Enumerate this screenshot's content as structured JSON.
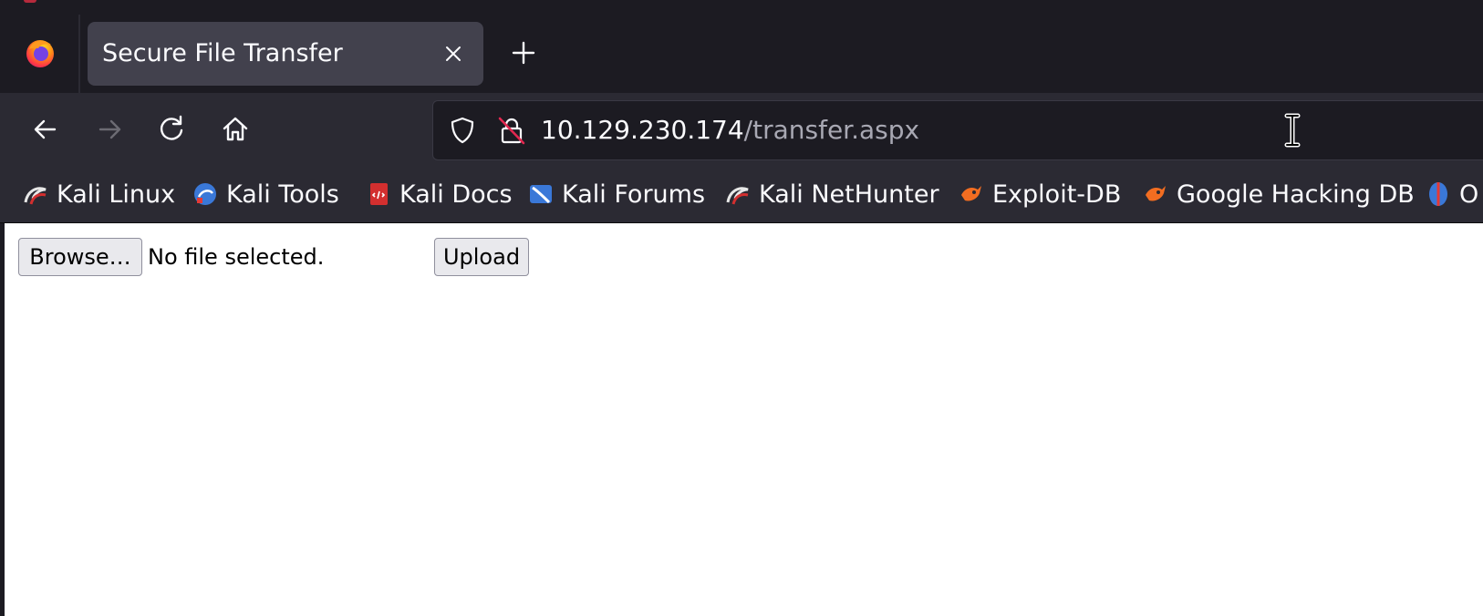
{
  "browser": {
    "logo_icon": "firefox-icon",
    "colors": {
      "chrome_dark": "#1c1b22",
      "toolbar": "#2b2a33",
      "tab_active": "#42414d",
      "text": "#fbfbfe",
      "url_path": "#a8a8b3"
    }
  },
  "tabs": [
    {
      "title": "Secure File Transfer",
      "close_icon": "close-icon",
      "active": true
    }
  ],
  "new_tab_icon": "plus-icon",
  "nav": {
    "back_icon": "arrow-left-icon",
    "forward_icon": "arrow-right-icon",
    "reload_icon": "reload-icon",
    "home_icon": "home-icon"
  },
  "urlbar": {
    "shield_icon": "shield-icon",
    "lock_icon": "insecure-lock-icon",
    "host": "10.129.230.174",
    "path": "/transfer.aspx"
  },
  "bookmarks": [
    {
      "label": "Kali Linux",
      "icon": "kali-dragon-icon"
    },
    {
      "label": "Kali Tools",
      "icon": "kali-tools-icon"
    },
    {
      "label": "Kali Docs",
      "icon": "kali-docs-icon"
    },
    {
      "label": "Kali Forums",
      "icon": "kali-forums-icon"
    },
    {
      "label": "Kali NetHunter",
      "icon": "kali-dragon-icon"
    },
    {
      "label": "Exploit-DB",
      "icon": "exploit-db-icon"
    },
    {
      "label": "Google Hacking DB",
      "icon": "exploit-db-icon"
    },
    {
      "label": "O",
      "icon": "offsec-icon"
    }
  ],
  "page": {
    "browse_label": "Browse…",
    "file_status": "No file selected.",
    "upload_label": "Upload"
  }
}
